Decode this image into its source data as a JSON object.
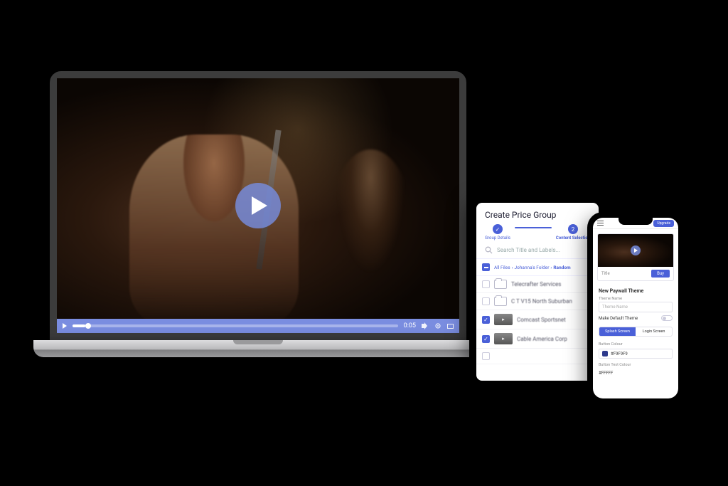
{
  "colors": {
    "accent": "#4a60d8",
    "accent_soft": "#7a8de0"
  },
  "laptop": {
    "play_label": "Play",
    "controls": {
      "time": "0:05"
    }
  },
  "tablet": {
    "title": "Create Price Group",
    "steps": [
      {
        "label": "Group Details",
        "state": "done"
      },
      {
        "label": "Content Selection",
        "state": "current"
      }
    ],
    "search_placeholder": "Search Title and Labels...",
    "breadcrumb": [
      "All Files",
      "Johanna's Folder",
      "Random"
    ],
    "rows": [
      {
        "checked": false,
        "kind": "folder",
        "label": "Telecrafter Services"
      },
      {
        "checked": false,
        "kind": "folder",
        "label": "C T V15 North Suburban"
      },
      {
        "checked": true,
        "kind": "video",
        "label": "Comcast Sportsnet"
      },
      {
        "checked": true,
        "kind": "video",
        "label": "Cable America Corp"
      }
    ]
  },
  "phone": {
    "topbar": {
      "upgrade": "Upgrade"
    },
    "preview": {
      "title_hint": "Title",
      "cta": "Buy"
    },
    "section_title": "New Paywall Theme",
    "theme_name_label": "Theme Name",
    "theme_name_placeholder": "Theme Name",
    "make_default_label": "Make Default Theme",
    "tabs": [
      "Splash Screen",
      "Login Screen"
    ],
    "button_colour_label": "Button Colour",
    "button_colour_value": "#F9F9F9",
    "button_text_colour_label": "Button Text Colour",
    "button_text_colour_value": "#FFFFF"
  }
}
